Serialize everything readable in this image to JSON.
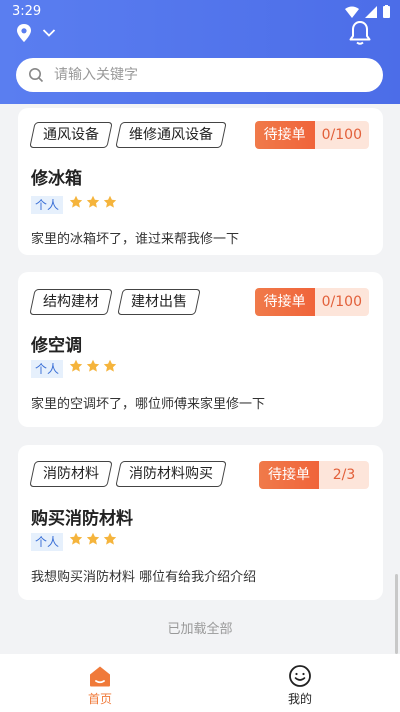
{
  "status_bar": {
    "time": "3:29"
  },
  "search": {
    "placeholder": "请输入关键字"
  },
  "cards": [
    {
      "tags": [
        "通风设备",
        "维修通风设备"
      ],
      "status": "待接单",
      "count": "0/100",
      "title": "修冰箱",
      "badge": "个人",
      "rating": 3,
      "description": "家里的冰箱坏了，谁过来帮我修一下"
    },
    {
      "tags": [
        "结构建材",
        "建材出售"
      ],
      "status": "待接单",
      "count": "0/100",
      "title": "修空调",
      "badge": "个人",
      "rating": 3,
      "description": "家里的空调坏了，哪位师傅来家里修一下"
    },
    {
      "tags": [
        "消防材料",
        "消防材料购买"
      ],
      "status": "待接单",
      "count": "2/3",
      "title": "购买消防材料",
      "badge": "个人",
      "rating": 3,
      "description": "我想购买消防材料 哪位有给我介绍介绍"
    }
  ],
  "footer": {
    "loaded_all": "已加载全部"
  },
  "tab_bar": {
    "tabs": [
      {
        "label": "首页",
        "icon": "home-icon",
        "active": true
      },
      {
        "label": "我的",
        "icon": "smiley-icon",
        "active": false
      }
    ]
  },
  "colors": {
    "header": "#5a7ef0",
    "accent": "#f0643a",
    "star": "#f5b43c",
    "active_tab": "#f07a3a"
  }
}
